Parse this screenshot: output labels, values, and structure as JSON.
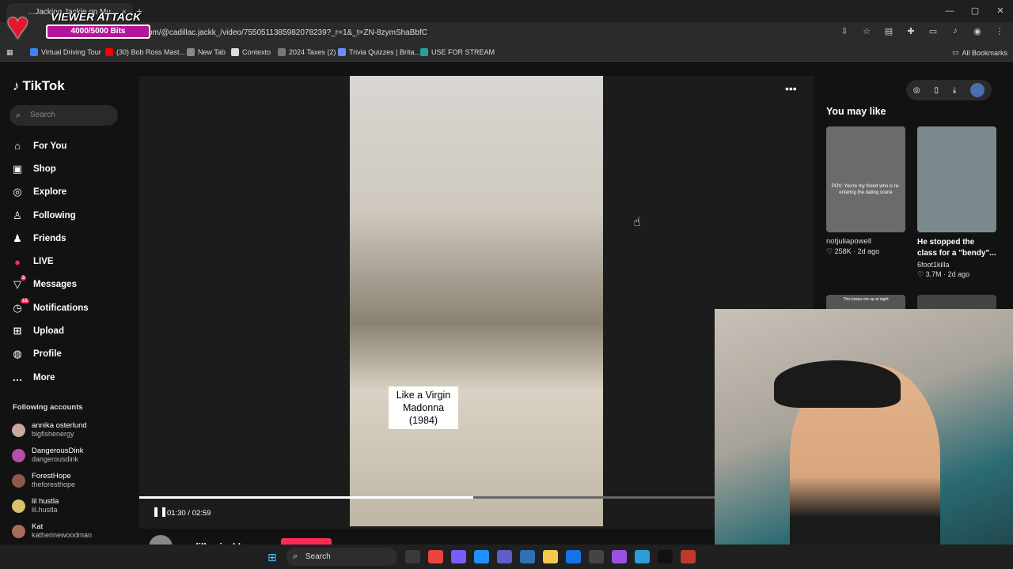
{
  "browser": {
    "tab_title": "...Jacking Jackie on Mu...",
    "tab_close": "×",
    "new_tab": "+",
    "url": "com/@cadillac.jackk_/video/7550511385982078239?_r=1&_t=ZN-8zymShaBbfC",
    "window_controls": [
      "—",
      "▢",
      "✕"
    ],
    "bookmarks": [
      {
        "label": "Virtual Driving Tour",
        "color": "#3b82f6"
      },
      {
        "label": "(30) Bob Ross Mast...",
        "color": "#ff0000"
      },
      {
        "label": "New Tab",
        "color": "#888888"
      },
      {
        "label": "Contexto",
        "color": "#dddddd"
      },
      {
        "label": "2024 Taxes (2)",
        "color": "#777777"
      },
      {
        "label": "Trivia Quizzes | Brita...",
        "color": "#6b8cff"
      },
      {
        "label": "USE FOR STREAM",
        "color": "#2aa198"
      }
    ],
    "all_bookmarks": "All Bookmarks"
  },
  "overlay": {
    "title": "VIEWER ATTACK",
    "progress": "4000/5000 Bits",
    "progress_fraction": 0.8
  },
  "tiktok": {
    "logo": "TikTok",
    "search_placeholder": "Search",
    "nav": [
      {
        "label": "For You",
        "icon": "home-icon",
        "glyph": "⌂"
      },
      {
        "label": "Shop",
        "icon": "shop-icon",
        "glyph": "▣"
      },
      {
        "label": "Explore",
        "icon": "compass-icon",
        "glyph": "◎"
      },
      {
        "label": "Following",
        "icon": "following-icon",
        "glyph": "♙"
      },
      {
        "label": "Friends",
        "icon": "friends-icon",
        "glyph": "♟"
      },
      {
        "label": "LIVE",
        "icon": "live-icon",
        "glyph": "●"
      },
      {
        "label": "Messages",
        "icon": "messages-icon",
        "glyph": "▽",
        "badge": "5"
      },
      {
        "label": "Notifications",
        "icon": "bell-icon",
        "glyph": "◷",
        "badge": "15"
      },
      {
        "label": "Upload",
        "icon": "upload-icon",
        "glyph": "⊞"
      },
      {
        "label": "Profile",
        "icon": "profile-avatar-icon",
        "glyph": "◍"
      },
      {
        "label": "More",
        "icon": "more-icon",
        "glyph": "…"
      }
    ],
    "following_accounts_title": "Following accounts",
    "following_accounts": [
      {
        "name": "annika osterlund",
        "username": "bigfishenergy",
        "color": "#c9a7a0"
      },
      {
        "name": "DangerousDink",
        "username": "dangerousdink",
        "color": "#b44fa8"
      },
      {
        "name": "ForestHope",
        "username": "theforesthope",
        "color": "#8b5a4a"
      },
      {
        "name": "lil hustla",
        "username": "lil.hustla",
        "color": "#d8c070"
      },
      {
        "name": "Kat",
        "username": "katherinewoodman",
        "color": "#a86a5a"
      }
    ],
    "video": {
      "caption_line1": "Like a Virgin",
      "caption_line2": "Madonna",
      "caption_line3": "(1984)",
      "time": "01:30 / 02:59",
      "progress_fraction": 0.58,
      "author": "cadillac.jackk"
    },
    "you_may_like": "You may like",
    "recommendations": [
      {
        "username": "notjuliapowell",
        "stats": "♡ 258K · 2d ago",
        "thumb_text": "POV: You're my friend who is re-entering the dating scene",
        "color": "#6d6a6a"
      },
      {
        "title": "He stopped the class for a \"bendy\"...",
        "username": "6foot1killa",
        "stats": "♡ 3.7M · 2d ago",
        "color": "#7a8a8c"
      }
    ],
    "rec_row2_text": "This keeps me up at night"
  },
  "taskbar": {
    "search": "Search"
  }
}
